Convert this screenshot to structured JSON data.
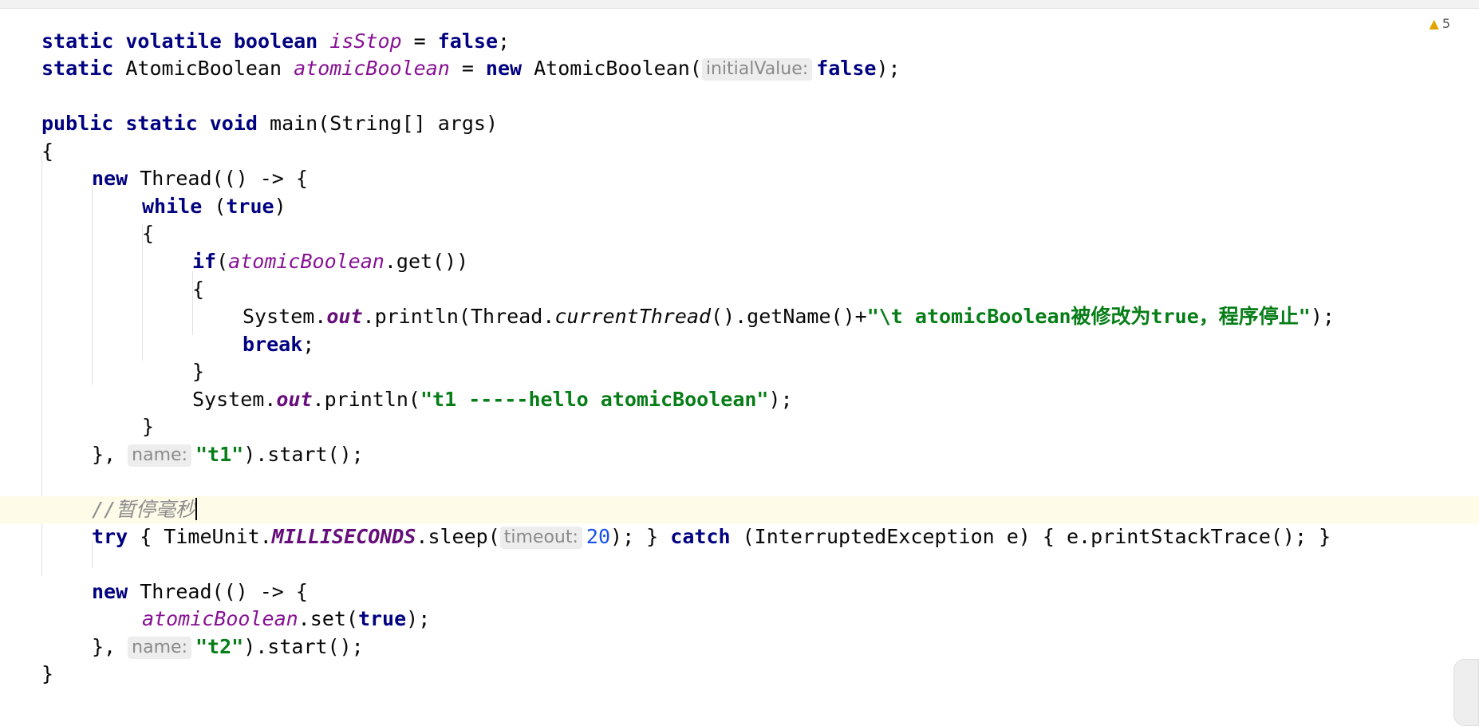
{
  "inspection": {
    "icon": "warning-triangle-icon",
    "count": "5"
  },
  "code": {
    "l1": {
      "static": "static",
      "volatile": "volatile",
      "boolean": "boolean",
      "field": "isStop",
      "eq": " = ",
      "false": "false",
      "end": ";"
    },
    "l2": {
      "static": "static",
      "type": " AtomicBoolean ",
      "field": "atomicBoolean",
      "eq": " = ",
      "new": "new",
      "ctor": " AtomicBoolean(",
      "hint": "initialValue:",
      "false": "false",
      "end": ");"
    },
    "l4": {
      "public": "public",
      "static": "static",
      "void": "void",
      "rest": " main(String[] args)"
    },
    "l5": {
      "text": "{"
    },
    "l6": {
      "new": "new",
      "rest": " Thread(() -> {"
    },
    "l7": {
      "while": "while",
      "open": " (",
      "true": "true",
      "close": ")"
    },
    "l8": {
      "text": "{"
    },
    "l9": {
      "if": "if",
      "open": "(",
      "field": "atomicBoolean",
      "rest": ".get())"
    },
    "l10": {
      "text": "{"
    },
    "l11": {
      "system": "System.",
      "out": "out",
      "println": ".println(Thread.",
      "current": "currentThread",
      "getname": "().getName()+",
      "string": "\"\\t atomicBoolean被修改为true，程序停止\"",
      "end": ");"
    },
    "l12": {
      "break": "break",
      "end": ";"
    },
    "l13": {
      "text": "}"
    },
    "l14": {
      "system": "System.",
      "out": "out",
      "println": ".println(",
      "string": "\"t1 -----hello atomicBoolean\"",
      "end": ");"
    },
    "l15": {
      "text": "}"
    },
    "l16": {
      "pre": "},",
      "hint": "name:",
      "string": "\"t1\"",
      "end": ").start();"
    },
    "l18": {
      "comment": "//暂停毫秒"
    },
    "l19": {
      "try": "try",
      "a": " { TimeUnit.",
      "ms": "MILLISECONDS",
      "b": ".sleep(",
      "hint": "timeout:",
      "num": "20",
      "c": "); } ",
      "catch": "catch",
      "d": " (InterruptedException e) { e.printStackTrace(); }"
    },
    "l21": {
      "new": "new",
      "rest": " Thread(() -> {"
    },
    "l22": {
      "field": "atomicBoolean",
      "a": ".set(",
      "true": "true",
      "b": ");"
    },
    "l23": {
      "pre": "},",
      "hint": "name:",
      "string": "\"t2\"",
      "end": ").start();"
    },
    "l24": {
      "text": "}"
    }
  }
}
